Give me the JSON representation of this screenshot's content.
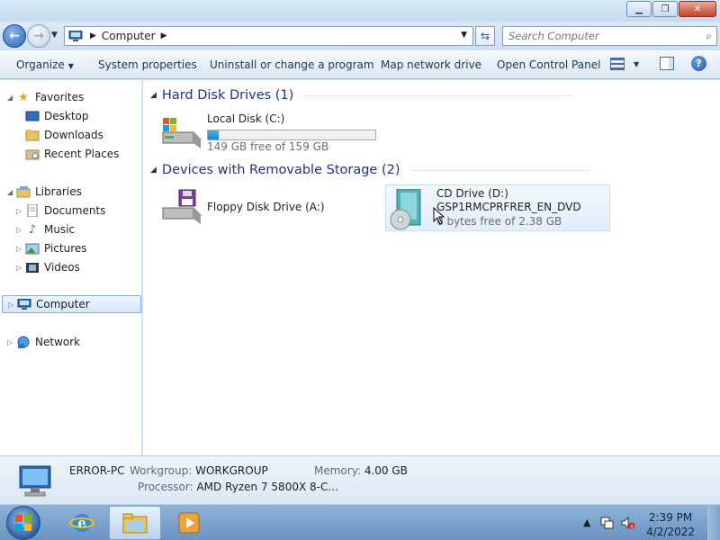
{
  "window": {
    "minimize_icon": "minimize-icon",
    "maximize_icon": "restore-icon",
    "close_icon": "close-icon"
  },
  "address": {
    "crumb": "Computer",
    "search_placeholder": "Search Computer"
  },
  "toolbar": {
    "organize": "Organize",
    "system_properties": "System properties",
    "uninstall": "Uninstall or change a program",
    "map_drive": "Map network drive",
    "control_panel": "Open Control Panel"
  },
  "nav": {
    "favorites": "Favorites",
    "desktop": "Desktop",
    "downloads": "Downloads",
    "recent_places": "Recent Places",
    "libraries": "Libraries",
    "documents": "Documents",
    "music": "Music",
    "pictures": "Pictures",
    "videos": "Videos",
    "computer": "Computer",
    "network": "Network"
  },
  "content": {
    "hdd_group": "Hard Disk Drives (1)",
    "removable_group": "Devices with Removable Storage (2)",
    "local_disk": {
      "name": "Local Disk (C:)",
      "free": "149 GB free of 159 GB",
      "used_fraction": 0.063
    },
    "floppy": {
      "name": "Floppy Disk Drive (A:)"
    },
    "cd": {
      "name": "CD Drive (D:)",
      "label": "GSP1RMCPRFRER_EN_DVD",
      "free": "0 bytes free of 2.38 GB"
    }
  },
  "details": {
    "computer_name": "ERROR-PC",
    "workgroup_label": "Workgroup:",
    "workgroup": "WORKGROUP",
    "memory_label": "Memory:",
    "memory": "4.00 GB",
    "processor_label": "Processor:",
    "processor": "AMD Ryzen 7 5800X 8-C..."
  },
  "taskbar": {
    "time": "2:39 PM",
    "date": "4/2/2022"
  },
  "colors": {
    "accent": "#1e3287",
    "selection": "#d5e7fb",
    "bar_fill": "#1b84cc"
  }
}
